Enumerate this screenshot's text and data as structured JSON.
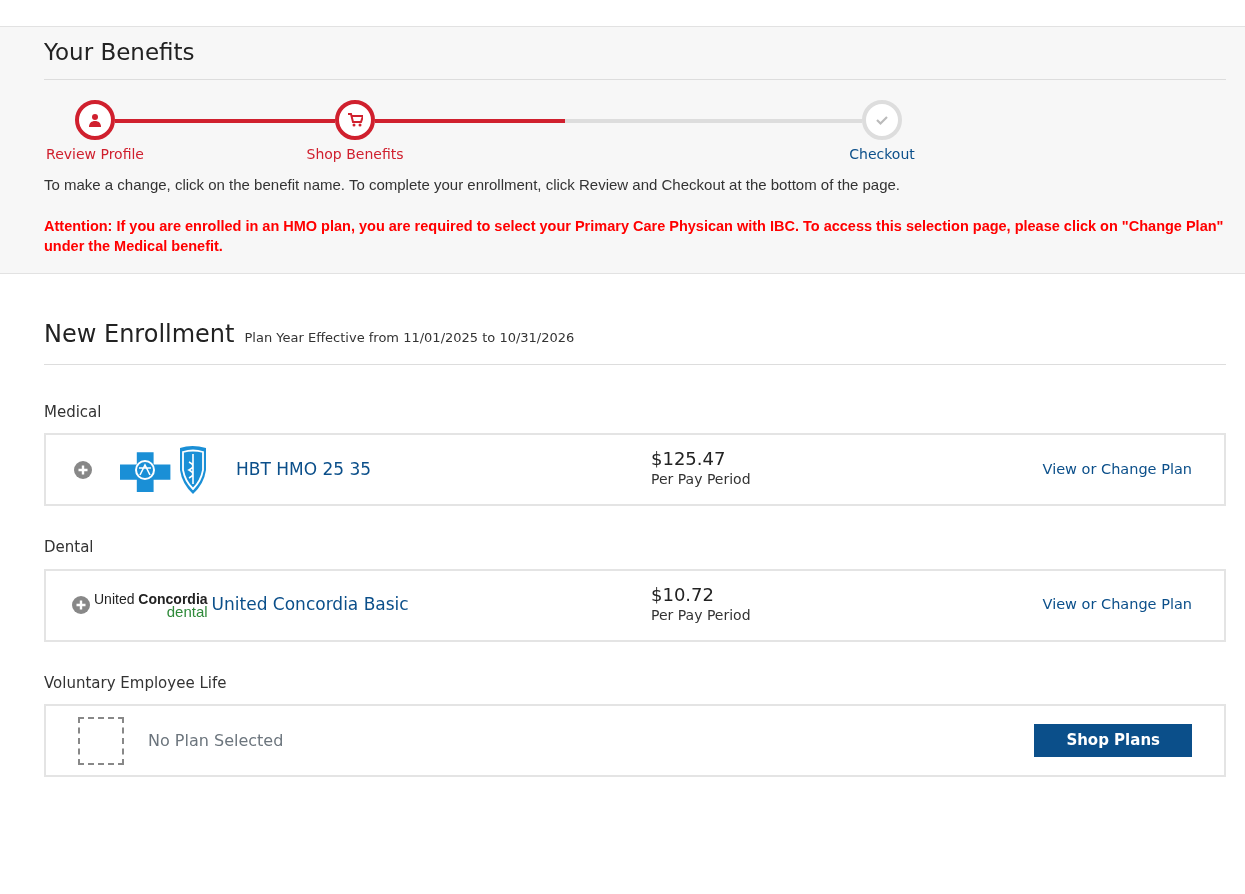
{
  "header": {
    "title": "Your Benefits"
  },
  "progress": {
    "connectors": [
      {
        "kind": "full",
        "done": true
      },
      {
        "kind": "partial",
        "level": 0.39
      }
    ],
    "steps": [
      {
        "label": "Review Profile",
        "kind": "person",
        "done": true
      },
      {
        "label": "Shop Benefits",
        "kind": "cart",
        "done": true
      },
      {
        "label": "Checkout",
        "kind": "check",
        "done": false
      }
    ]
  },
  "instructions": "To make a change, click on the benefit name. To complete your enrollment, click Review and Checkout at the bottom of the page.",
  "attention": "Attention: If you are enrolled in an HMO plan, you are required to select your Primary Care Physican with IBC.  To access this selection page, please click on \"Change Plan\" under the Medical benefit.",
  "enrollment": {
    "title": "New Enrollment",
    "subtitle": "Plan Year Effective from 11/01/2025 to 10/31/2026"
  },
  "benefits": [
    {
      "category": "Medical",
      "kind": "plan",
      "logo": {
        "kind": "cross-shield"
      },
      "plan": "HBT HMO 25 35",
      "price": "$125.47",
      "period": "Per Pay Period",
      "action": "View or Change Plan"
    },
    {
      "category": "Dental",
      "kind": "plan",
      "logo": {
        "kind": "wordmark",
        "words": [
          "United",
          "Concordia",
          "dental"
        ]
      },
      "plan": "United Concordia Basic",
      "price": "$10.72",
      "period": "Per Pay Period",
      "action": "View or Change Plan"
    },
    {
      "category": "Voluntary Employee Life",
      "kind": "empty",
      "plan": "No Plan Selected",
      "action": "Shop Plans"
    }
  ]
}
